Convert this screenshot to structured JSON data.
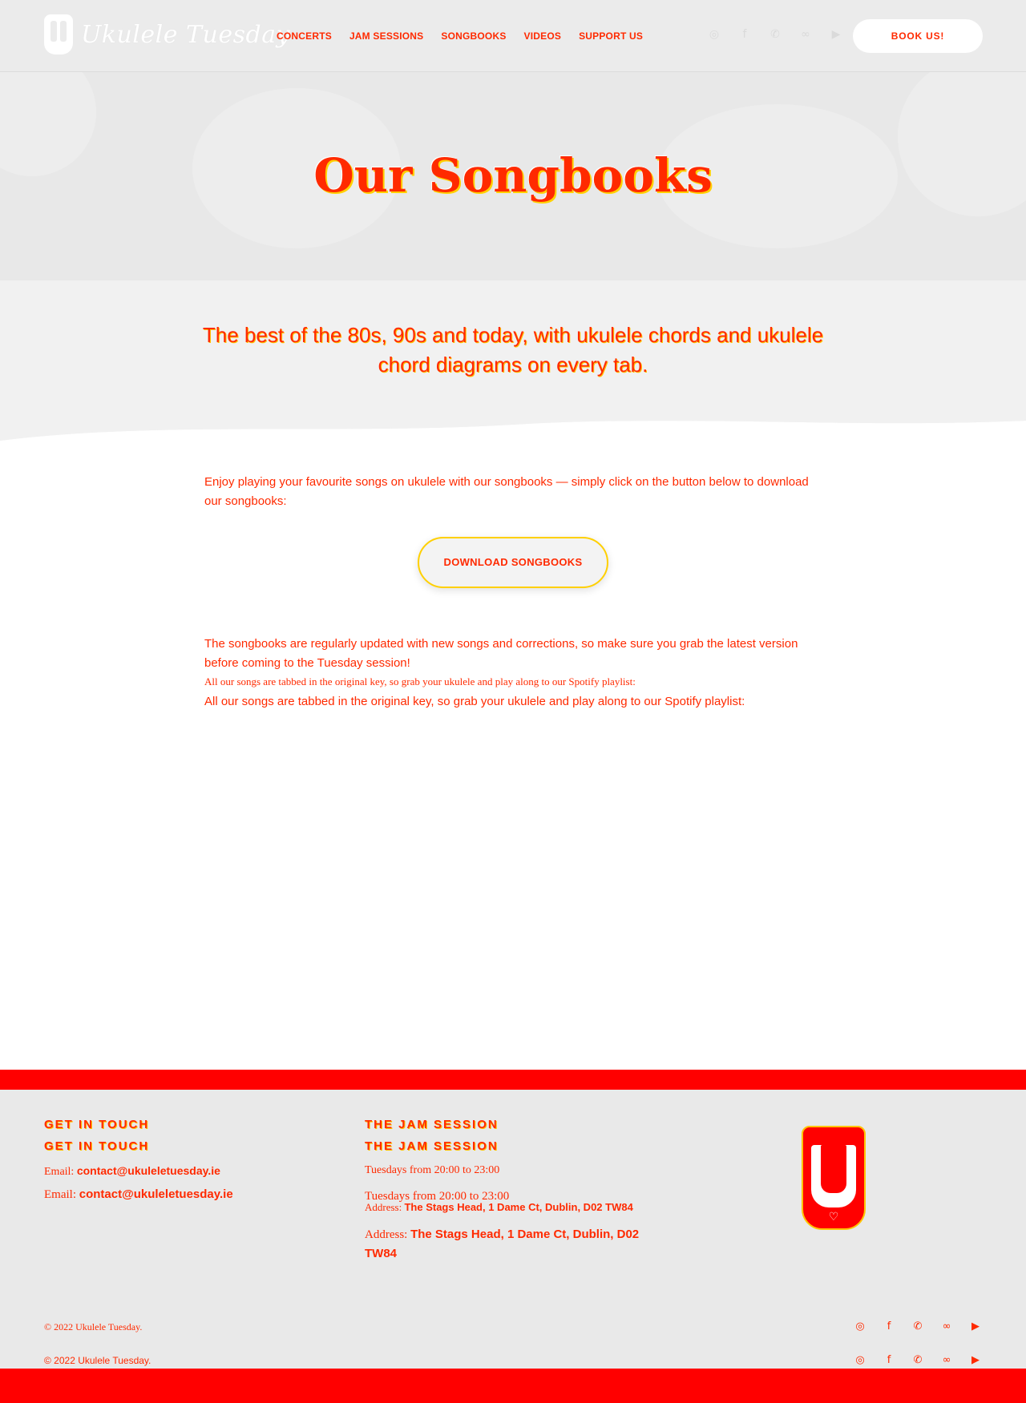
{
  "header": {
    "logo_text": "Ukulele Tuesday",
    "nav": [
      "CONCERTS",
      "JAM SESSIONS",
      "SONGBOOKS",
      "VIDEOS",
      "SUPPORT US"
    ],
    "social_icons": [
      "instagram-icon",
      "facebook-icon",
      "whatsapp-icon",
      "tripadvisor-icon",
      "youtube-icon"
    ],
    "book_button": "BOOK US!"
  },
  "hero": {
    "title": "Our Songbooks"
  },
  "intro": {
    "text": "The best of the 80s, 90s and today, with ukulele chords and ukulele chord diagrams on every tab."
  },
  "content": {
    "para1": "Enjoy playing your favourite songs on ukulele with our songbooks — simply click on the button below to download our songbooks:",
    "download_button": "DOWNLOAD SONGBOOKS",
    "para2": "The songbooks are regularly updated with new songs and corrections, so make sure you grab the latest version before coming to the Tuesday session!",
    "small_line": "All our songs are tabbed in the original key, so grab your ukulele and play along to our Spotify playlist:",
    "para3": "All our songs are tabbed in the original key, so grab your ukulele and play along to our Spotify playlist:"
  },
  "footer": {
    "get_in_touch": "GET IN TOUCH",
    "email_label": "Email:",
    "email": "contact@ukuleletuesday.ie",
    "jam_session": "THE JAM SESSION",
    "hours": "Tuesdays from 20:00 to 23:00",
    "address_label": "Address:",
    "address": "The Stags Head, 1 Dame Ct, Dublin, D02 TW84",
    "copyright": "© 2022 Ukulele Tuesday."
  },
  "colors": {
    "accent": "#ff2a00",
    "highlight": "#ffd000",
    "bar": "#ff0000"
  }
}
